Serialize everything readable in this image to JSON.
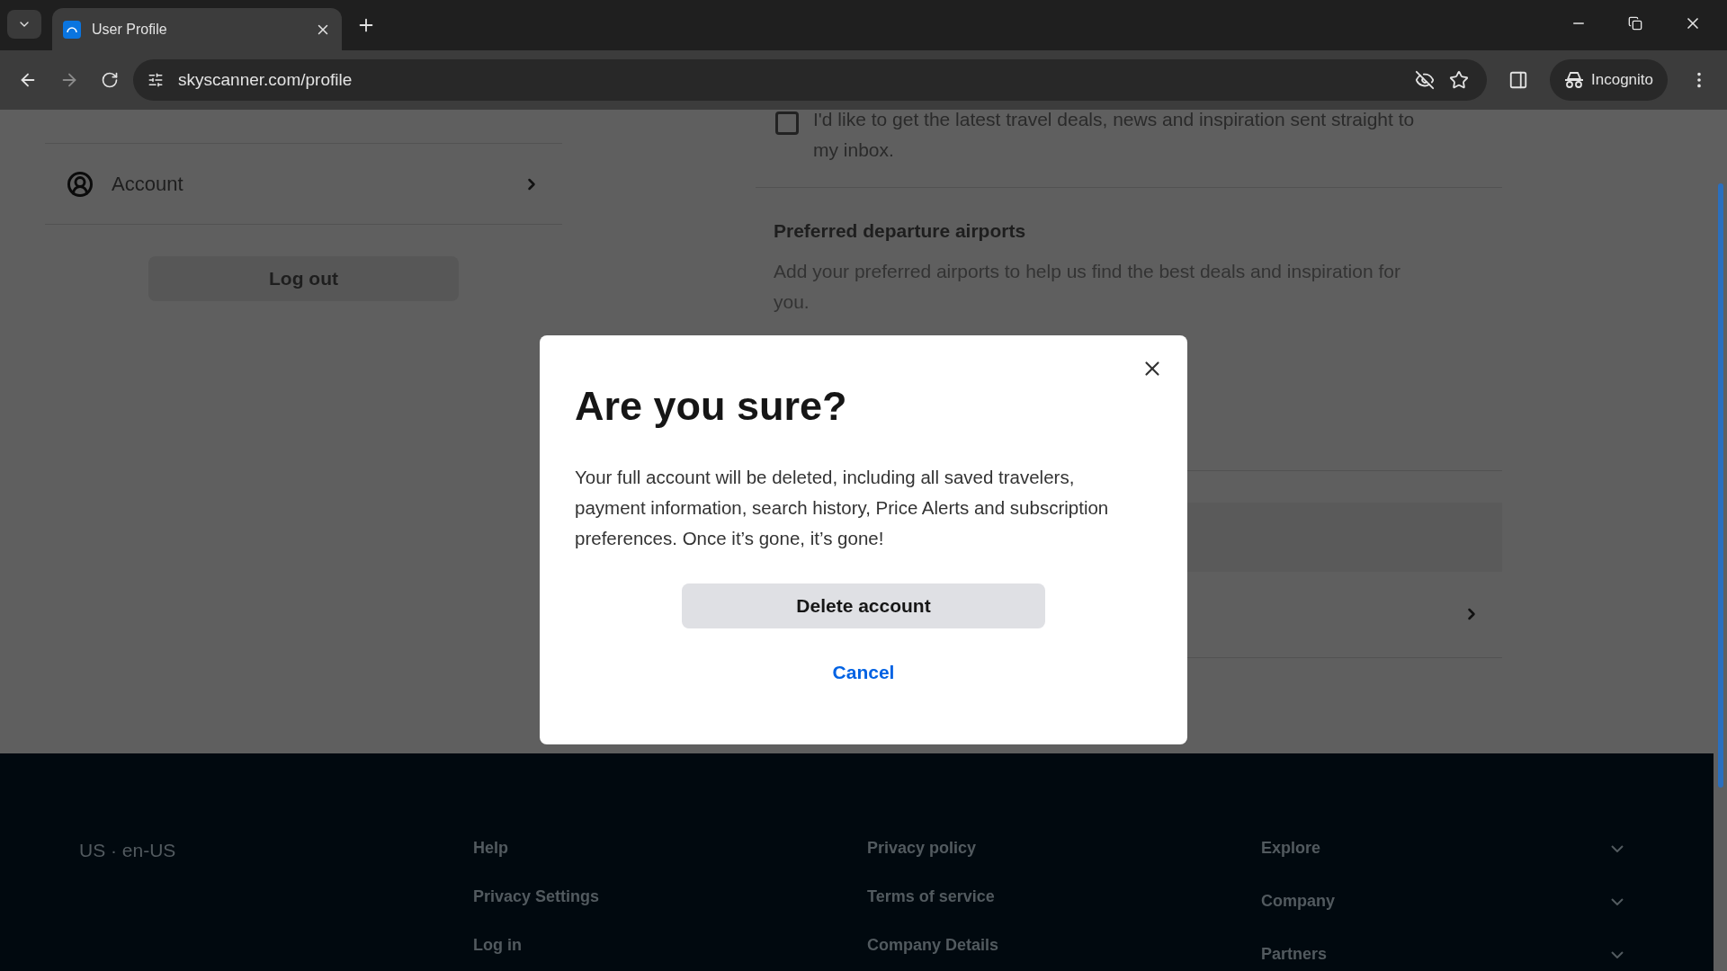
{
  "browser": {
    "tab_title": "User Profile",
    "url": "skyscanner.com/profile",
    "incognito_label": "Incognito"
  },
  "sidebar": {
    "items": [
      {
        "label": "Account"
      }
    ],
    "logout": "Log out"
  },
  "settings": {
    "newsletter": {
      "label": "I'd like to get the latest travel deals, news and inspiration sent straight to my inbox.",
      "checked": false
    },
    "airports": {
      "title": "Preferred departure airports",
      "description": "Add your preferred airports to help us find the best deals and inspiration for you."
    }
  },
  "dialog": {
    "title": "Are you sure?",
    "body": "Your full account will be deleted, including all saved travelers, payment information, search history, Price Alerts and subscription preferences. Once it’s gone, it’s gone!",
    "confirm": "Delete account",
    "cancel": "Cancel"
  },
  "footer": {
    "locale": "US · en-US",
    "link_columns": [
      [
        "Help",
        "Privacy Settings",
        "Log in"
      ],
      [
        "Privacy policy",
        "Terms of service",
        "Company Details"
      ]
    ],
    "sections": [
      {
        "label": "Explore",
        "expanded": false
      },
      {
        "label": "Company",
        "expanded": false
      },
      {
        "label": "Partners",
        "expanded": false
      }
    ]
  }
}
